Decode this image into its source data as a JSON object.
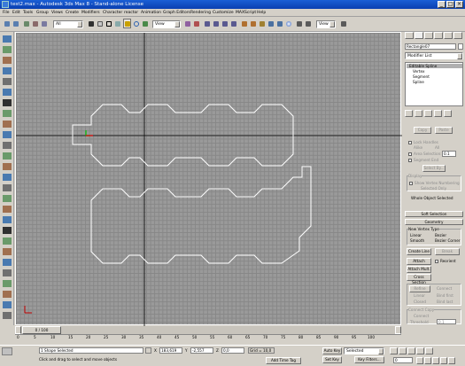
{
  "window": {
    "title": "test2.max - Autodesk 3ds Max 8 - Stand-alone License"
  },
  "menu": [
    "File",
    "Edit",
    "Tools",
    "Group",
    "Views",
    "Create",
    "Modifiers",
    "Character",
    "reactor",
    "Animation",
    "Graph Editors",
    "Rendering",
    "Customize",
    "MAXScript",
    "Help"
  ],
  "toolbar": {
    "selection_filter": "All",
    "ref_coord": "View",
    "named_selection": "View"
  },
  "command_panel": {
    "object_name": "Rectangle07",
    "modifier_list": "Modifier List",
    "stack": [
      "Editable Spline",
      "Vertex",
      "Segment",
      "Spline"
    ],
    "selection": {
      "copy": "Copy",
      "paste": "Paste",
      "lock_handles": "Lock Handles",
      "alike": "Alike",
      "all": "All",
      "area_selection": "Area Selection:",
      "area_value": "0.1",
      "segment_end": "Segment End",
      "select_by": "Select By...",
      "display": "Display",
      "show_vertex_numbering": "Show Vertex Numbering",
      "selected_only": "Selected Only",
      "status": "Whole Object Selected"
    },
    "soft_selection": "Soft Selection",
    "geometry": {
      "title": "Geometry",
      "new_vertex_type": "New Vertex Type",
      "linear": "Linear",
      "bezier": "Bezier",
      "smooth": "Smooth",
      "bezier_corner": "Bezier Corner",
      "create_line": "Create Line",
      "break": "Break",
      "attach": "Attach",
      "reorient": "Reorient",
      "attach_mult": "Attach Mult.",
      "cross_section": "Cross Section",
      "refine": "Refine",
      "connect": "Connect",
      "linear2": "Linear",
      "bind_first": "Bind first",
      "closed": "Closed",
      "bind_last": "Bind last",
      "connect_copy": "Connect Copy",
      "connect2": "Connect",
      "threshold": "Threshold",
      "threshold_value": "0.1",
      "end_point_auto_welding": "End Point Auto-Welding",
      "automatic_welding": "Automatic Welding"
    }
  },
  "timeline": {
    "frame_label": "0 / 100",
    "ticks": [
      "0",
      "5",
      "10",
      "15",
      "20",
      "25",
      "30",
      "35",
      "40",
      "45",
      "50",
      "55",
      "60",
      "65",
      "70",
      "75",
      "80",
      "85",
      "90",
      "95",
      "100"
    ]
  },
  "status": {
    "selection": "1 Shape Selected",
    "prompt": "Click and drag to select and move objects",
    "x": "183,619",
    "y": "-2,557",
    "z": "0,0",
    "grid": "Grid = 10,0",
    "add_time_tag": "Add Time Tag",
    "auto_key": "Auto Key",
    "selected": "Selected",
    "set_key": "Set Key",
    "key_filters": "Key Filters...",
    "frame": "0"
  }
}
